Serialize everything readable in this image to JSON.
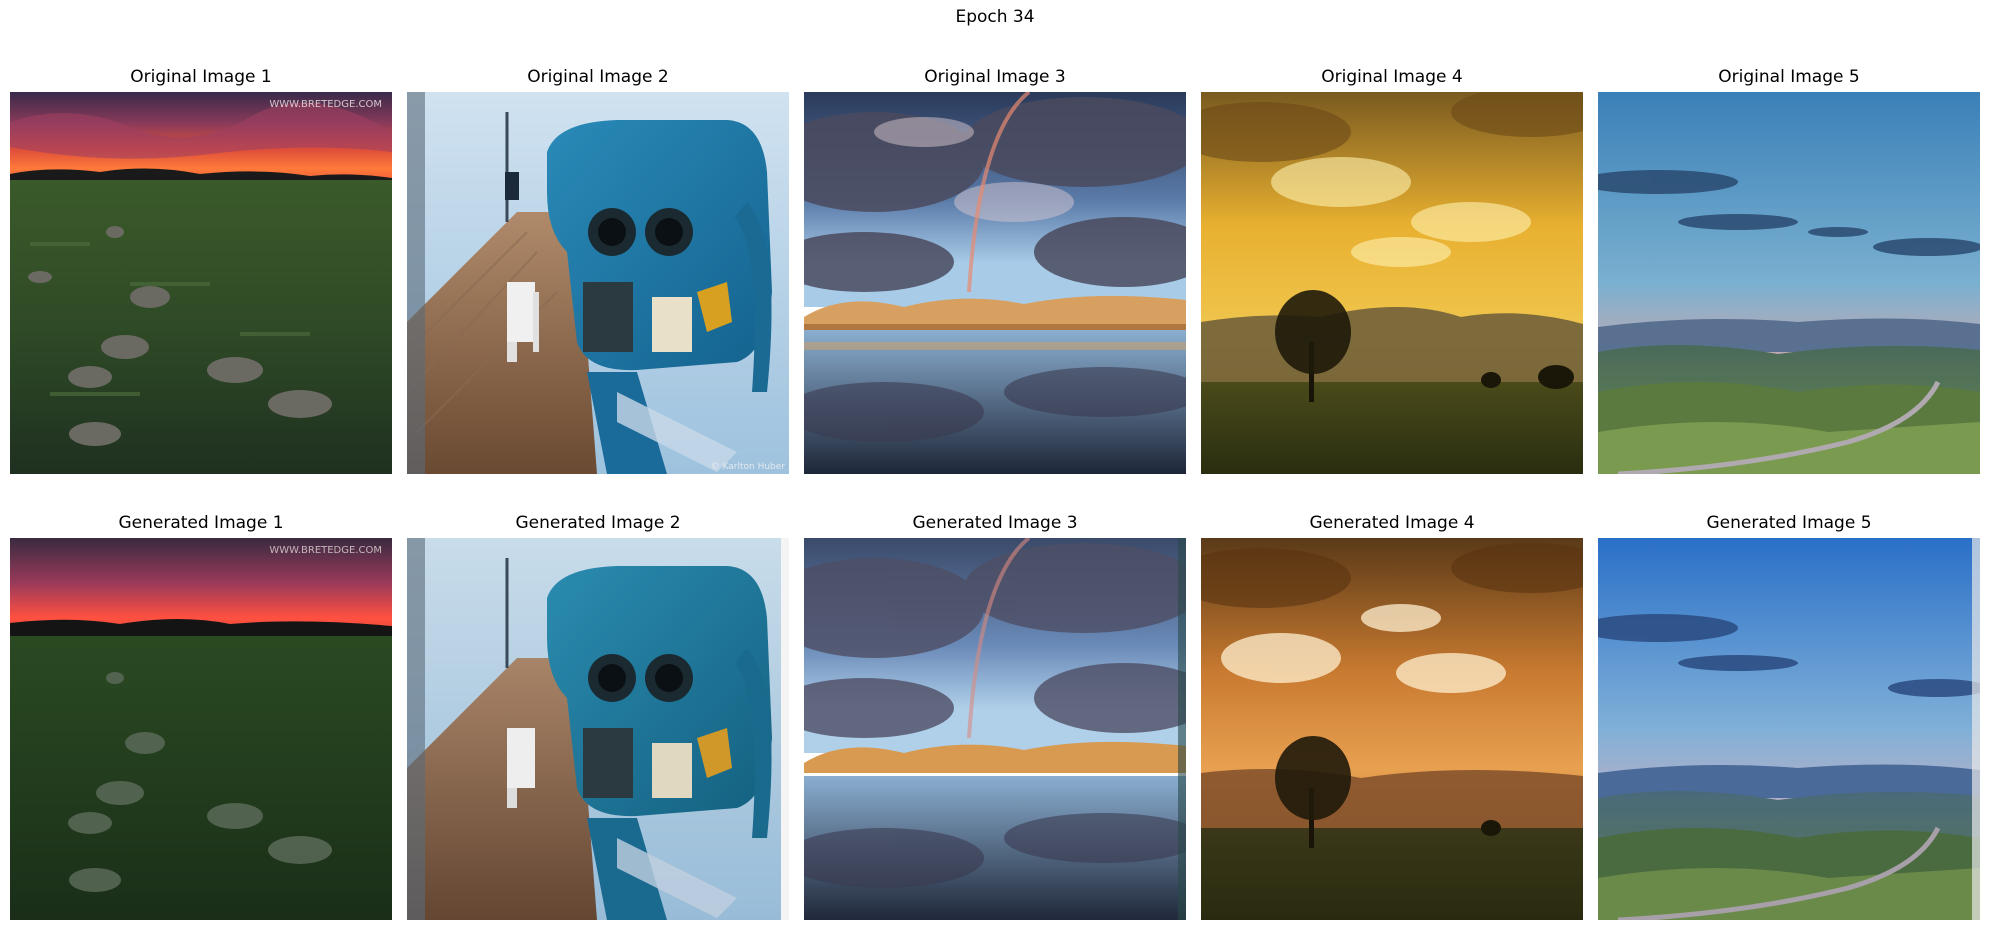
{
  "figure": {
    "title": "Epoch 34",
    "original_captions": [
      "Original Image 1",
      "Original Image 2",
      "Original Image 3",
      "Original Image 4",
      "Original Image 5"
    ],
    "generated_captions": [
      "Generated Image 1",
      "Generated Image 2",
      "Generated Image 3",
      "Generated Image 4",
      "Generated Image 5"
    ],
    "watermarks": {
      "image1": "WWW.BRETEDGE.COM",
      "image2": "© Karlton Huber"
    }
  }
}
